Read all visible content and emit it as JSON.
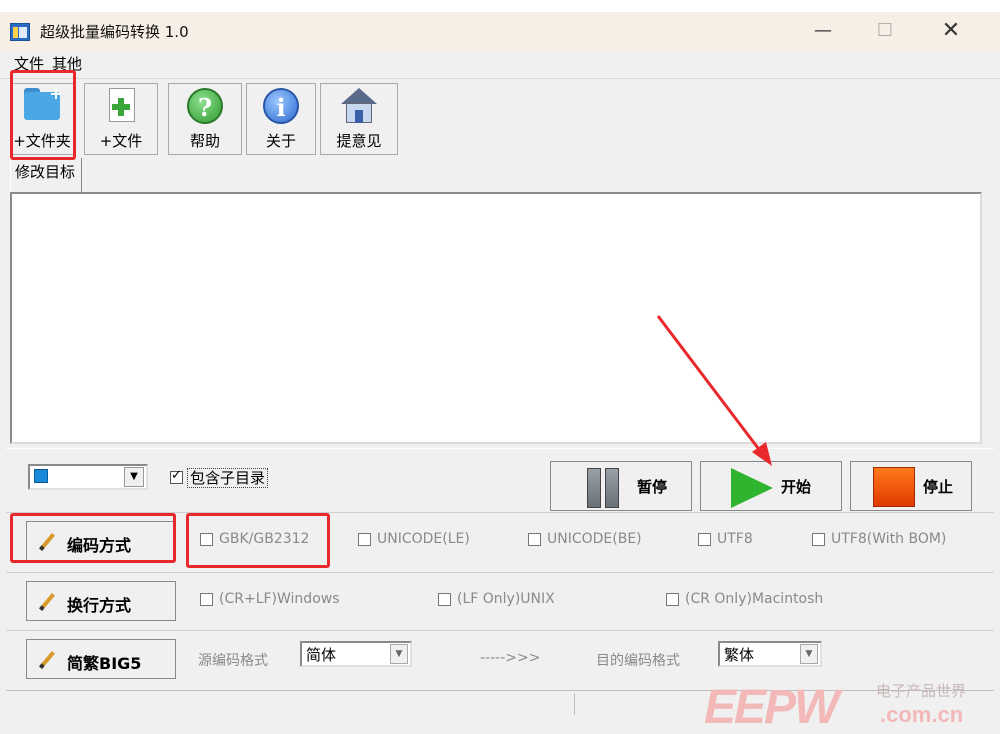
{
  "window": {
    "title": "超级批量编码转换 1.0",
    "controls": {
      "minimize": "—",
      "maximize": "☐",
      "close": "✕"
    }
  },
  "menu": [
    {
      "label": "文件"
    },
    {
      "label": "其他"
    }
  ],
  "toolbar": [
    {
      "label": "+文件夹",
      "icon": "folder-add-icon"
    },
    {
      "label": "+文件",
      "icon": "file-add-icon"
    },
    {
      "label": "帮助",
      "icon": "help-icon",
      "glyph": "?"
    },
    {
      "label": "关于",
      "icon": "info-icon",
      "glyph": "i"
    },
    {
      "label": "提意见",
      "icon": "house-icon"
    }
  ],
  "tab": {
    "label": "修改目标"
  },
  "controls": {
    "include_subdirs_label": "包含子目录",
    "include_subdirs_checked": true,
    "pause_label": "暂停",
    "start_label": "开始",
    "stop_label": "停止"
  },
  "encoding": {
    "button_label": "编码方式",
    "options": [
      "GBK/GB2312",
      "UNICODE(LE)",
      "UNICODE(BE)",
      "UTF8",
      "UTF8(With BOM)"
    ]
  },
  "line_ending": {
    "button_label": "换行方式",
    "options": [
      "(CR+LF)Windows",
      "(LF Only)UNIX",
      "(CR Only)Macintosh"
    ]
  },
  "big5": {
    "button_label": "简繁BIG5",
    "source_label": "源编码格式",
    "source_value": "简体",
    "arrow_text": "----->>>",
    "target_label": "目的编码格式",
    "target_value": "繁体"
  },
  "watermark": {
    "logo": "EEPW",
    "cn_text": "电子产品世界",
    "url": ".com.cn"
  },
  "colors": {
    "annotation_red": "#e8282a",
    "start_green": "#2fb42f",
    "stop_orange": "#ff5a0a"
  }
}
